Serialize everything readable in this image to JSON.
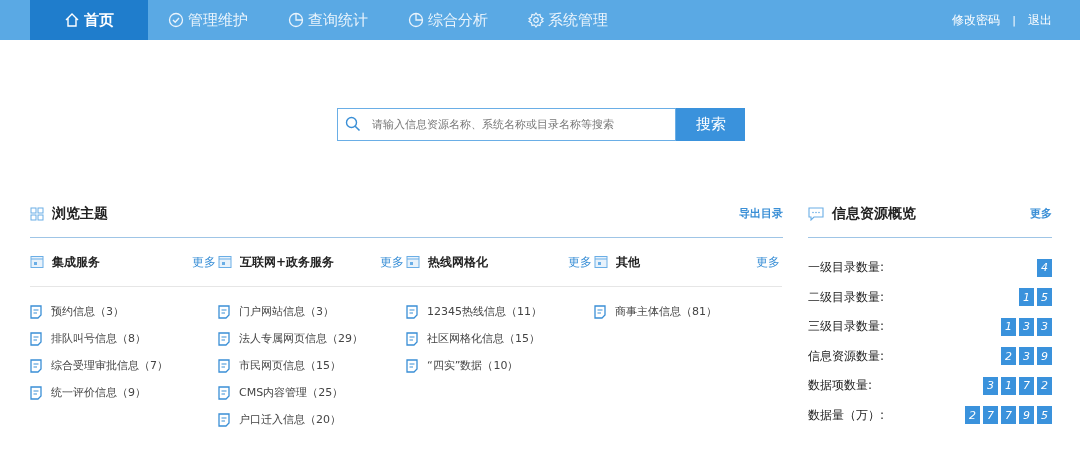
{
  "nav": {
    "items": [
      {
        "label": "首页",
        "kind": "home",
        "selected": true
      },
      {
        "label": "管理维护",
        "kind": "check",
        "selected": false
      },
      {
        "label": "查询统计",
        "kind": "chart",
        "selected": false
      },
      {
        "label": "综合分析",
        "kind": "chart",
        "selected": false
      },
      {
        "label": "系统管理",
        "kind": "settings",
        "selected": false
      }
    ],
    "links": [
      "修改密码",
      "退出"
    ],
    "separator": "|"
  },
  "search": {
    "placeholder": "请输入信息资源名称、系统名称或目录名称等搜索",
    "button": "搜索"
  },
  "browse": {
    "title": "浏览主题",
    "export": "导出目录",
    "groups": [
      {
        "title": "集成服务",
        "more": "更多",
        "items": [
          "预约信息（3）",
          "排队叫号信息（8）",
          "综合受理审批信息（7）",
          "统一评价信息（9）"
        ]
      },
      {
        "title": "互联网+政务服务",
        "more": "更多",
        "items": [
          "门户网站信息（3）",
          "法人专属网页信息（29）",
          "市民网页信息（15）",
          "CMS内容管理（25）",
          "户口迁入信息（20）"
        ]
      },
      {
        "title": "热线网格化",
        "more": "更多",
        "items": [
          "12345热线信息（11）",
          "社区网格化信息（15）",
          "“四实”数据（10）"
        ]
      },
      {
        "title": "其他",
        "more": "更多",
        "items": [
          "商事主体信息（81）"
        ]
      }
    ]
  },
  "overview": {
    "title": "信息资源概览",
    "more": "更多",
    "stats": [
      {
        "label": "一级目录数量:",
        "digits": [
          "4"
        ]
      },
      {
        "label": "二级目录数量:",
        "digits": [
          "1",
          "5"
        ]
      },
      {
        "label": "三级目录数量:",
        "digits": [
          "1",
          "3",
          "3"
        ]
      },
      {
        "label": "信息资源数量:",
        "digits": [
          "2",
          "3",
          "9"
        ]
      },
      {
        "label": "数据项数量:",
        "digits": [
          "3",
          "1",
          "7",
          "2"
        ]
      },
      {
        "label": "数据量（万）:",
        "digits": [
          "2",
          "7",
          "7",
          "9",
          "5"
        ]
      }
    ]
  }
}
